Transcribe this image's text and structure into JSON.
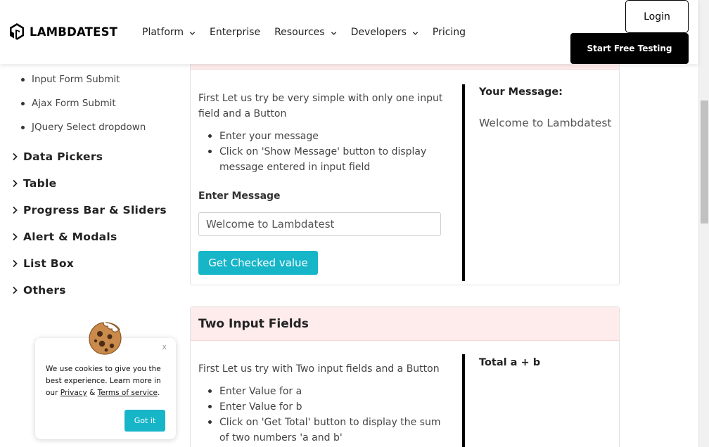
{
  "header": {
    "logo_text": "LAMBDATEST",
    "nav": [
      {
        "label": "Platform",
        "dropdown": true
      },
      {
        "label": "Enterprise",
        "dropdown": false
      },
      {
        "label": "Resources",
        "dropdown": true
      },
      {
        "label": "Developers",
        "dropdown": true
      },
      {
        "label": "Pricing",
        "dropdown": false
      }
    ],
    "login_label": "Login",
    "start_label": "Start Free Testing"
  },
  "sidebar": {
    "sub_items": [
      "Input Form Submit",
      "Ajax Form Submit",
      "JQuery Select dropdown"
    ],
    "categories": [
      "Data Pickers",
      "Table",
      "Progress Bar & Sliders",
      "Alert & Modals",
      "List Box",
      "Others"
    ]
  },
  "cookie": {
    "text_1": "We use cookies to give you the best experience. Learn more in our",
    "privacy_link": "Privacy",
    "amp": "&",
    "terms_link": "Terms of service",
    "period": ".",
    "close_label": "x",
    "button_label": "Got it"
  },
  "single_input": {
    "description": "First Let us try be very simple with only one input field and a Button",
    "bullets": [
      "Enter your message",
      "Click on 'Show Message' button to display message entered in input field"
    ],
    "field_label": "Enter Message",
    "input_value": "Welcome to Lambdatest",
    "button_label": "Get Checked value",
    "result_label": "Your Message:",
    "result_value": "Welcome to Lambdatest"
  },
  "two_input": {
    "title": "Two Input Fields",
    "description": "First Let us try with Two input fields and a Button",
    "bullets": [
      "Enter Value for a",
      "Enter Value for b",
      "Click on 'Get Total' button to display the sum of two numbers 'a and b'"
    ],
    "result_label": "Total a + b"
  },
  "colors": {
    "accent": "#17b5c8",
    "panel_header": "#fdeceb",
    "header_button": "#000000"
  }
}
